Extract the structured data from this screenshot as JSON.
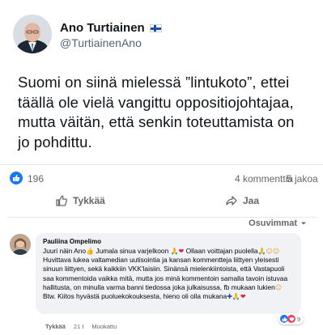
{
  "tweet": {
    "author_name": "Ano Turtiainen",
    "author_handle": "@TurtiainenAno",
    "text_lines": [
      "Suomi on siinä mielessä ”lintukoto”, ettei",
      "täällä ole vielä vangittu oppositiojohtajaa,",
      "mutta väitän, että senkin toteuttamista on",
      "jo pohdittu."
    ]
  },
  "stats": {
    "likes": "196",
    "comments": "4 kommenttia",
    "shares": "5 jakoa"
  },
  "actions": {
    "like": "Tykkää",
    "share": "Jaa"
  },
  "sort": {
    "label": "Osuvimmat"
  },
  "comment": {
    "author": "Pauliina Ompelimo",
    "body_parts": [
      "Juuri näin Ano",
      " Jumala sinua varjelkoon ",
      " Ollaan voittajan puolella",
      " Huvittava lukea valtamedian uutisointia ja kansan kommentteja liittyen yleisesti sinuun liittyen, sekä kaikkiin VKK'laisiin. Sinänsä mielenkiintoista, että Vastapuoli saa kommentoida vaikka mitä, mutta jos minä kommentoin samalla tavoin istuvaa hallitusta, on minulla varma banni tiedossa joka julkaisussa, fb mukaan lukien",
      " Btw. Kiitos hyvästä puoluekokouksesta, hieno oli olla mukana"
    ],
    "reaction_count": "9",
    "meta": {
      "like": "Tykkää",
      "time": "21 t",
      "edited": "Muokattu"
    }
  },
  "colors": {
    "facebook_blue": "#1877f2",
    "love_red": "#f33e58",
    "bubble_bg": "#f0f2f5",
    "secondary_text": "#65676b"
  },
  "icons": [
    "thumbs-up-icon",
    "share-arrow-icon",
    "chevron-down-icon",
    "heart-icon",
    "pray-icon",
    "smile-icon",
    "finland-flag-icon"
  ]
}
